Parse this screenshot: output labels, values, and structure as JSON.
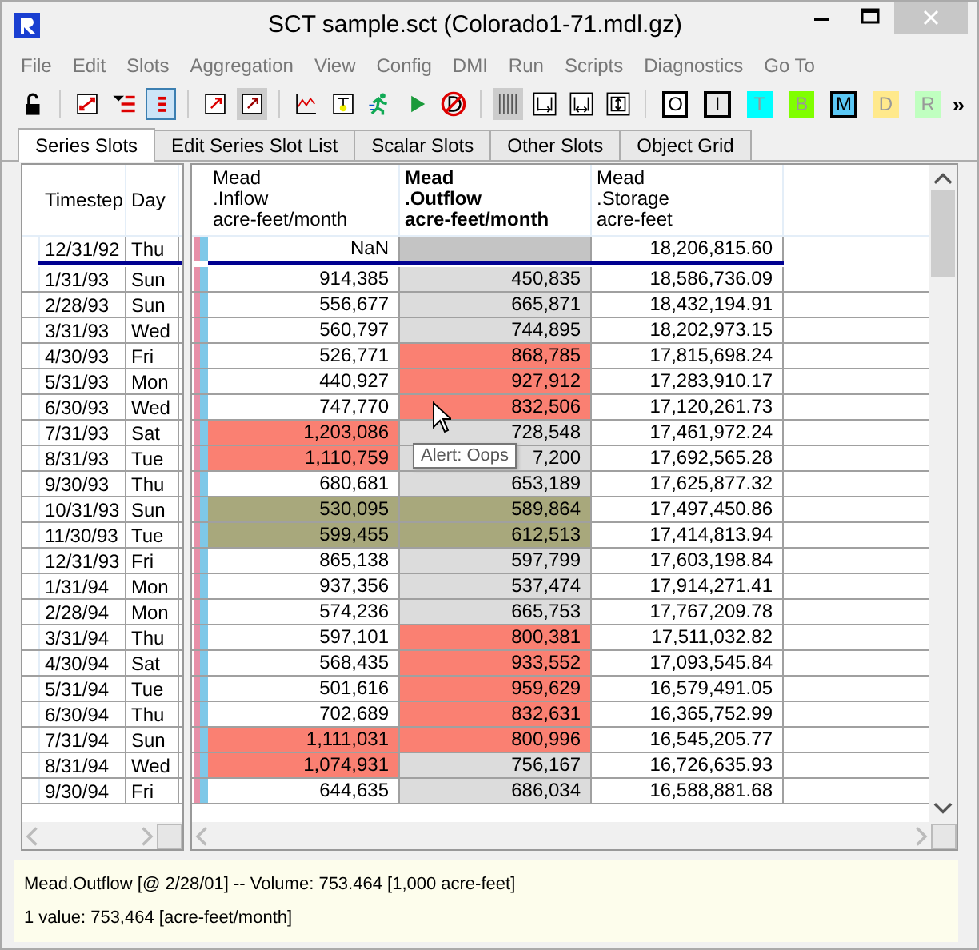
{
  "window": {
    "title": "SCT sample.sct (Colorado1-71.mdl.gz)"
  },
  "menu": [
    "File",
    "Edit",
    "Slots",
    "Aggregation",
    "View",
    "Config",
    "DMI",
    "Run",
    "Scripts",
    "Diagnostics",
    "Go To"
  ],
  "tools": [
    {
      "pressed": false,
      "disabled": false
    },
    {
      "pressed": false,
      "disabled": false
    },
    {
      "pressed": false,
      "disabled": false
    },
    {
      "pressed": true,
      "disabled": false
    },
    {
      "pressed": false,
      "disabled": false
    },
    {
      "pressed": false,
      "disabled": true
    },
    {
      "pressed": false,
      "disabled": false
    },
    {
      "pressed": false,
      "disabled": false
    },
    {
      "pressed": false,
      "disabled": false
    },
    {
      "pressed": false,
      "disabled": false
    },
    {
      "pressed": false,
      "disabled": false
    },
    {
      "pressed": false,
      "disabled": true
    },
    {
      "pressed": false,
      "disabled": false
    },
    {
      "pressed": false,
      "disabled": false
    },
    {
      "pressed": false,
      "disabled": false
    }
  ],
  "letter_buttons": [
    {
      "label": "O",
      "color": "#ffffff",
      "disabled": false
    },
    {
      "label": "I",
      "color": "#e8e8e8",
      "disabled": false
    },
    {
      "label": "T",
      "color": "#00ffff",
      "disabled": true
    },
    {
      "label": "B",
      "color": "#80ff00",
      "disabled": true
    },
    {
      "label": "M",
      "color": "#5bc8f5",
      "disabled": false
    },
    {
      "label": "D",
      "color": "#ffe98c",
      "disabled": true
    },
    {
      "label": "R",
      "color": "#c0ffc0",
      "disabled": true
    }
  ],
  "overflow": "»",
  "tabs": [
    {
      "label": "Series Slots",
      "selected": true
    },
    {
      "label": "Edit Series Slot List",
      "selected": false
    },
    {
      "label": "Scalar Slots",
      "selected": false
    },
    {
      "label": "Other Slots",
      "selected": false
    },
    {
      "label": "Object Grid",
      "selected": false
    }
  ],
  "left_columns": [
    "Timestep",
    "Day"
  ],
  "columns": [
    {
      "lines": [
        "Mead",
        ".Inflow",
        "acre-feet/month"
      ],
      "selected": false
    },
    {
      "lines": [
        "Mead",
        ".Outflow",
        "acre-feet/month"
      ],
      "selected": true
    },
    {
      "lines": [
        "Mead",
        ".Storage",
        "acre-feet"
      ],
      "selected": false
    }
  ],
  "initial_row": {
    "timestep": "12/31/92",
    "day": "Thu",
    "cells": [
      {
        "value": "NaN"
      },
      {
        "color": "#c4c4c4"
      },
      {
        "value": "18,206,815.60"
      }
    ]
  },
  "rows": [
    {
      "timestep": "1/31/93",
      "day": "Sun",
      "cells": [
        {
          "value": "914,385"
        },
        {
          "value": "450,835"
        },
        {
          "value": "18,586,736.09"
        }
      ]
    },
    {
      "timestep": "2/28/93",
      "day": "Sun",
      "cells": [
        {
          "value": "556,677"
        },
        {
          "value": "665,871"
        },
        {
          "value": "18,432,194.91"
        }
      ]
    },
    {
      "timestep": "3/31/93",
      "day": "Wed",
      "cells": [
        {
          "value": "560,797"
        },
        {
          "value": "744,895"
        },
        {
          "value": "18,202,973.15"
        }
      ]
    },
    {
      "timestep": "4/30/93",
      "day": "Fri",
      "cells": [
        {
          "value": "526,771"
        },
        {
          "value": "868,785",
          "color": "#fa8072"
        },
        {
          "value": "17,815,698.24"
        }
      ]
    },
    {
      "timestep": "5/31/93",
      "day": "Mon",
      "cells": [
        {
          "value": "440,927"
        },
        {
          "value": "927,912",
          "color": "#fa8072"
        },
        {
          "value": "17,283,910.17"
        }
      ]
    },
    {
      "timestep": "6/30/93",
      "day": "Wed",
      "cells": [
        {
          "value": "747,770"
        },
        {
          "value": "832,506",
          "color": "#fa8072"
        },
        {
          "value": "17,120,261.73"
        }
      ]
    },
    {
      "timestep": "7/31/93",
      "day": "Sat",
      "cells": [
        {
          "value": "1,203,086",
          "color": "#fa8072"
        },
        {
          "value": "728,548"
        },
        {
          "value": "17,461,972.24"
        }
      ]
    },
    {
      "timestep": "8/31/93",
      "day": "Tue",
      "cells": [
        {
          "value": "1,110,759",
          "color": "#fa8072"
        },
        {
          "value": "7,200"
        },
        {
          "value": "17,692,565.28"
        }
      ]
    },
    {
      "timestep": "9/30/93",
      "day": "Thu",
      "cells": [
        {
          "value": "680,681"
        },
        {
          "value": "653,189"
        },
        {
          "value": "17,625,877.32"
        }
      ]
    },
    {
      "timestep": "10/31/93",
      "day": "Sun",
      "cells": [
        {
          "value": "530,095",
          "color": "#a8a87c"
        },
        {
          "value": "589,864",
          "color": "#a8a87c"
        },
        {
          "value": "17,497,450.86"
        }
      ]
    },
    {
      "timestep": "11/30/93",
      "day": "Tue",
      "cells": [
        {
          "value": "599,455",
          "color": "#a8a87c"
        },
        {
          "value": "612,513",
          "color": "#a8a87c"
        },
        {
          "value": "17,414,813.94"
        }
      ]
    },
    {
      "timestep": "12/31/93",
      "day": "Fri",
      "cells": [
        {
          "value": "865,138"
        },
        {
          "value": "597,799"
        },
        {
          "value": "17,603,198.84"
        }
      ]
    },
    {
      "timestep": "1/31/94",
      "day": "Mon",
      "cells": [
        {
          "value": "937,356"
        },
        {
          "value": "537,474"
        },
        {
          "value": "17,914,271.41"
        }
      ]
    },
    {
      "timestep": "2/28/94",
      "day": "Mon",
      "cells": [
        {
          "value": "574,236"
        },
        {
          "value": "665,753"
        },
        {
          "value": "17,767,209.78"
        }
      ]
    },
    {
      "timestep": "3/31/94",
      "day": "Thu",
      "cells": [
        {
          "value": "597,101"
        },
        {
          "value": "800,381",
          "color": "#fa8072"
        },
        {
          "value": "17,511,032.82"
        }
      ]
    },
    {
      "timestep": "4/30/94",
      "day": "Sat",
      "cells": [
        {
          "value": "568,435"
        },
        {
          "value": "933,552",
          "color": "#fa8072"
        },
        {
          "value": "17,093,545.84"
        }
      ]
    },
    {
      "timestep": "5/31/94",
      "day": "Tue",
      "cells": [
        {
          "value": "501,616"
        },
        {
          "value": "959,629",
          "color": "#fa8072"
        },
        {
          "value": "16,579,491.05"
        }
      ]
    },
    {
      "timestep": "6/30/94",
      "day": "Thu",
      "cells": [
        {
          "value": "702,689"
        },
        {
          "value": "832,631",
          "color": "#fa8072"
        },
        {
          "value": "16,365,752.99"
        }
      ]
    },
    {
      "timestep": "7/31/94",
      "day": "Sun",
      "cells": [
        {
          "value": "1,111,031",
          "color": "#fa8072"
        },
        {
          "value": "800,996",
          "color": "#fa8072"
        },
        {
          "value": "16,545,205.77"
        }
      ]
    },
    {
      "timestep": "8/31/94",
      "day": "Wed",
      "cells": [
        {
          "value": "1,074,931",
          "color": "#fa8072"
        },
        {
          "value": "756,167"
        },
        {
          "value": "16,726,635.93"
        }
      ]
    },
    {
      "timestep": "9/30/94",
      "day": "Fri",
      "cells": [
        {
          "value": "644,635"
        },
        {
          "value": "686,034"
        },
        {
          "value": "16,588,881.68"
        }
      ]
    }
  ],
  "tooltip": "Alert: Oops",
  "status": [
    "Mead.Outflow [@ 2/28/01] -- Volume: 753.464 [1,000 acre-feet]",
    "1 value:  753,464 [acre-feet/month]"
  ]
}
